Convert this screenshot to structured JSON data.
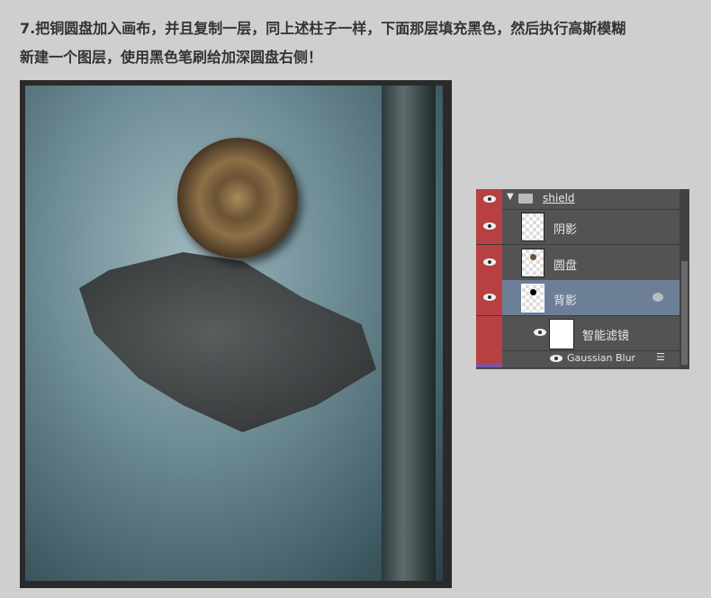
{
  "caption": {
    "line1": "7.把铜圆盘加入画布，并且复制一层，同上述柱子一样，下面那层填充黑色，然后执行高斯模糊",
    "line2": "新建一个图层，使用黑色笔刷给加深圆盘右侧！"
  },
  "layers": {
    "group": "shield",
    "items": [
      {
        "name": "阴影"
      },
      {
        "name": "圆盘"
      },
      {
        "name": "背影"
      }
    ],
    "smart_filter": "智能滤镜",
    "filter": "Gaussian Blur"
  },
  "colors": {
    "visibility_column": "#b84040",
    "selected_row": "#6c7f97",
    "panel": "#535353"
  }
}
